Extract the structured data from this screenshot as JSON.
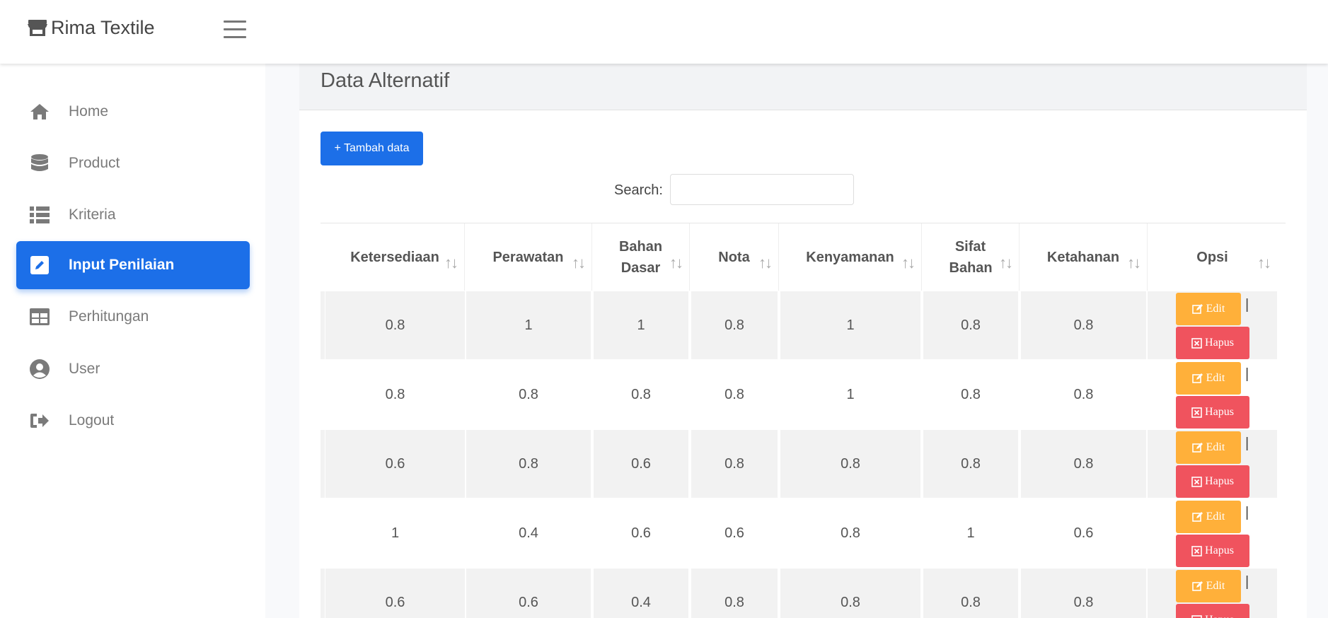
{
  "app": {
    "brand": "Rima Textile"
  },
  "sidebar": {
    "items": [
      {
        "label": "Home",
        "icon": "home-icon"
      },
      {
        "label": "Product",
        "icon": "database-icon"
      },
      {
        "label": "Kriteria",
        "icon": "list-icon"
      },
      {
        "label": "Input Penilaian",
        "icon": "edit-square-icon",
        "active": true
      },
      {
        "label": "Perhitungan",
        "icon": "table-icon"
      },
      {
        "label": "User",
        "icon": "user-circle-icon"
      },
      {
        "label": "Logout",
        "icon": "logout-icon"
      }
    ]
  },
  "page": {
    "title": "Data Alternatif"
  },
  "toolbar": {
    "add_label": "+ Tambah data",
    "search_label": "Search:",
    "search_value": ""
  },
  "table": {
    "columns": [
      "Ketersediaan",
      "Perawatan",
      "Bahan Dasar",
      "Nota",
      "Kenyamanan",
      "Sifat Bahan",
      "Ketahanan",
      "Opsi"
    ],
    "sort_glyph": "↑↓",
    "edit_label": "Edit",
    "hapus_label": "Hapus",
    "rows": [
      [
        "0.8",
        "1",
        "1",
        "0.8",
        "1",
        "0.8",
        "0.8"
      ],
      [
        "0.8",
        "0.8",
        "0.8",
        "0.8",
        "1",
        "0.8",
        "0.8"
      ],
      [
        "0.6",
        "0.8",
        "0.6",
        "0.8",
        "0.8",
        "0.8",
        "0.8"
      ],
      [
        "1",
        "0.4",
        "0.6",
        "0.6",
        "0.8",
        "1",
        "0.6"
      ],
      [
        "0.6",
        "0.6",
        "0.4",
        "0.8",
        "0.8",
        "0.8",
        "0.8"
      ]
    ]
  },
  "colors": {
    "primary": "#1c6fe8",
    "warning": "#ffb03a",
    "danger": "#f0535e"
  }
}
